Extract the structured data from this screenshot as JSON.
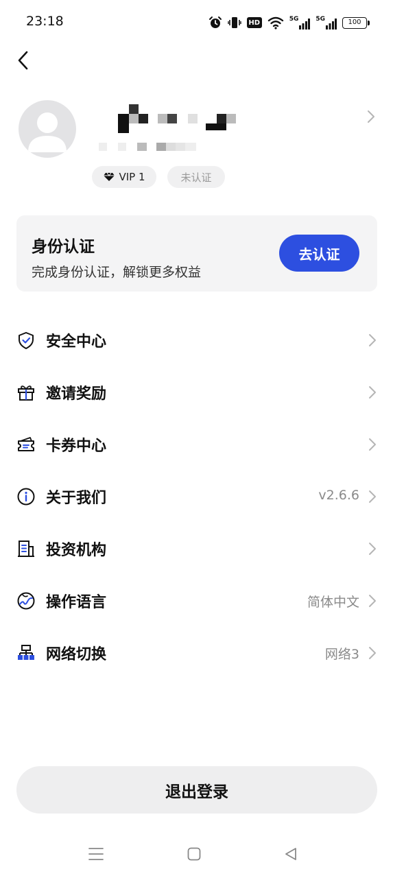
{
  "status_bar": {
    "time": "23:18",
    "hd_label": "HD",
    "signal_labels": [
      "5G",
      "5G"
    ],
    "battery": "100"
  },
  "header": {
    "back_icon": "chevron-left-icon"
  },
  "profile": {
    "avatar_icon": "user-placeholder-icon",
    "badges": {
      "vip": "VIP 1",
      "verification": "未认证"
    },
    "chevron_icon": "chevron-right-icon"
  },
  "identity_card": {
    "title": "身份认证",
    "description": "完成身份认证，解锁更多权益",
    "button_label": "去认证"
  },
  "menu": {
    "items": [
      {
        "label": "安全中心",
        "value": "",
        "icon": "shield-check-icon"
      },
      {
        "label": "邀请奖励",
        "value": "",
        "icon": "gift-icon"
      },
      {
        "label": "卡券中心",
        "value": "",
        "icon": "ticket-icon"
      },
      {
        "label": "关于我们",
        "value": "v2.6.6",
        "icon": "info-icon"
      },
      {
        "label": "投资机构",
        "value": "",
        "icon": "building-icon"
      },
      {
        "label": "操作语言",
        "value": "简体中文",
        "icon": "globe-icon"
      },
      {
        "label": "网络切换",
        "value": "网络3",
        "icon": "network-icon"
      }
    ]
  },
  "logout_label": "退出登录",
  "nav_bar": {
    "menu_icon": "menu-lines-icon",
    "home_icon": "square-home-icon",
    "back_icon": "triangle-back-icon"
  },
  "colors": {
    "accent": "#2d4fe0",
    "icon_accent": "#2d4fe0",
    "card_bg": "#f4f4f5",
    "muted_text": "#8a8a8a"
  }
}
